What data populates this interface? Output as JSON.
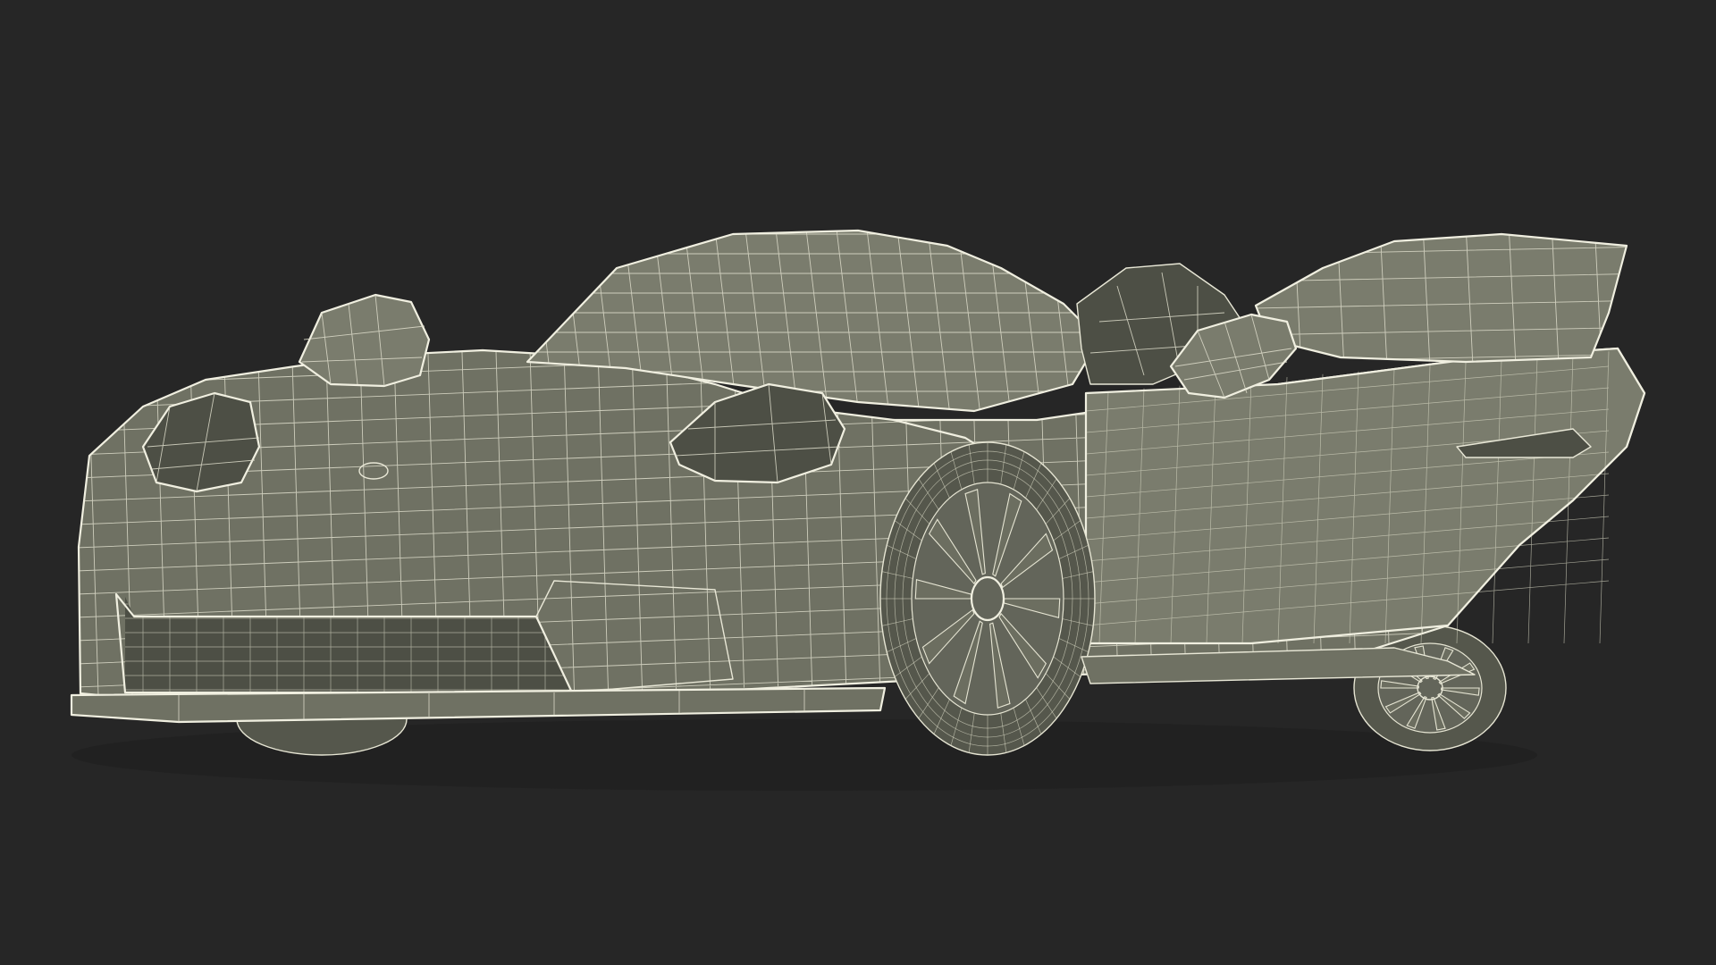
{
  "scene": {
    "background_color": "#262626",
    "model_base_color": "#6f7163",
    "wire_color": "#e8e7d6",
    "subject": "car-wireframe-render"
  },
  "wheels": {
    "front_spokes": 10,
    "rear_spokes": 10
  }
}
